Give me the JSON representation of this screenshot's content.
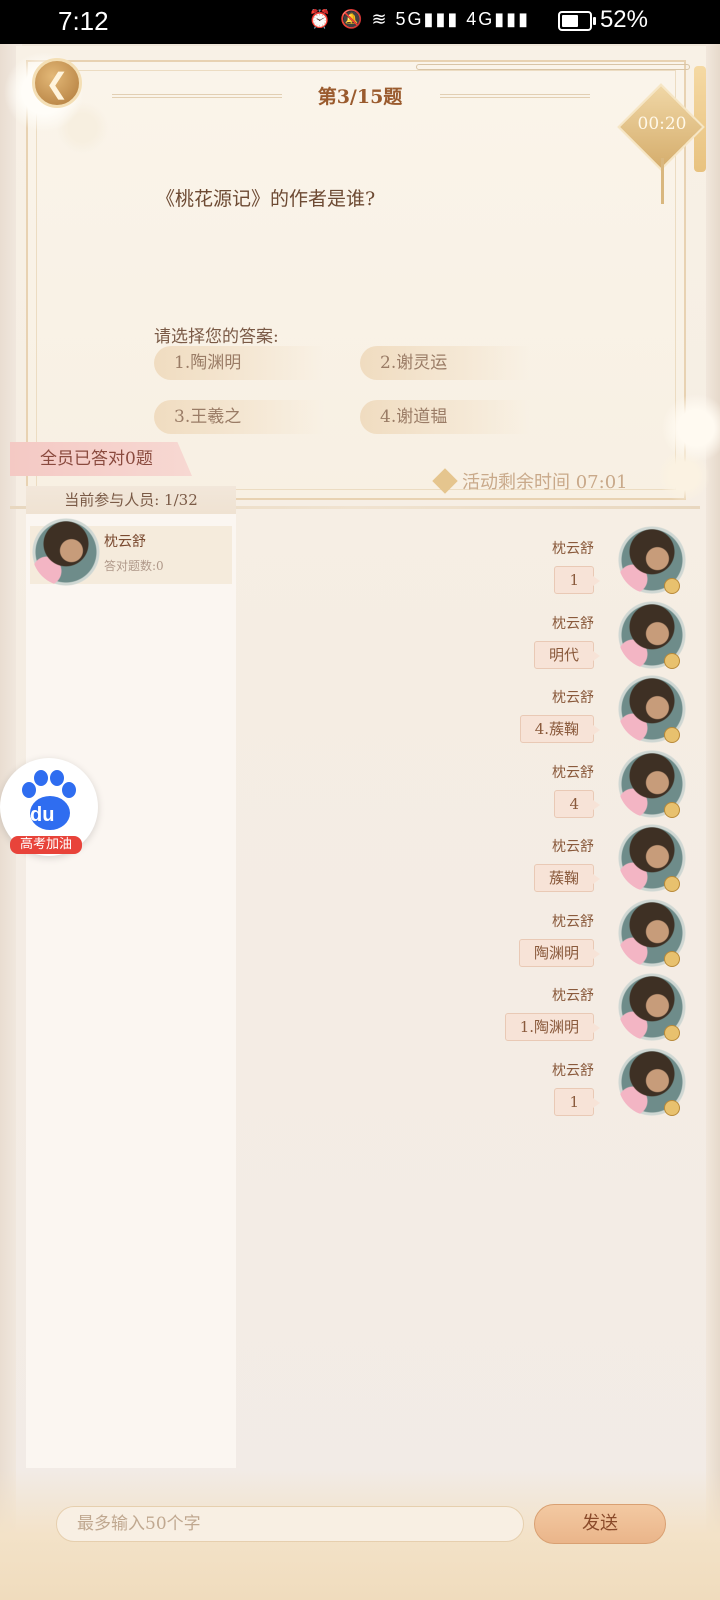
{
  "status_bar": {
    "time": "7:12",
    "icons": "⏰ 🔕 ≋ 5G▮▮▮ 4G▮▮▮",
    "battery": "52%"
  },
  "header": {
    "question_counter": "第3/15题",
    "timer": "00:20"
  },
  "question": {
    "text": "《桃花源记》的作者是谁?",
    "prompt": "请选择您的答案:",
    "options": [
      "1.陶渊明",
      "2.谢灵运",
      "3.王羲之",
      "4.谢道韫"
    ]
  },
  "banner": {
    "correct_count": "全员已答对0题",
    "remaining_time": "活动剩余时间 07:01"
  },
  "participants": {
    "title": "当前参与人员: 1/32",
    "list": [
      {
        "name": "枕云舒",
        "score": "答对题数:0"
      }
    ]
  },
  "messages": [
    {
      "name": "枕云舒",
      "text": "1"
    },
    {
      "name": "枕云舒",
      "text": "明代"
    },
    {
      "name": "枕云舒",
      "text": "4.蔟鞠"
    },
    {
      "name": "枕云舒",
      "text": "4"
    },
    {
      "name": "枕云舒",
      "text": "蔟鞠"
    },
    {
      "name": "枕云舒",
      "text": "陶渊明"
    },
    {
      "name": "枕云舒",
      "text": "1.陶渊明"
    },
    {
      "name": "枕云舒",
      "text": "1"
    }
  ],
  "floating_widget": {
    "logo_text": "du",
    "tag": "高考加油"
  },
  "input": {
    "placeholder": "最多输入50个字",
    "send_label": "发送"
  },
  "colors": {
    "accent": "#9a5b2e",
    "bubble": "#f7e3d7",
    "baidu_blue": "#2f6df0"
  }
}
